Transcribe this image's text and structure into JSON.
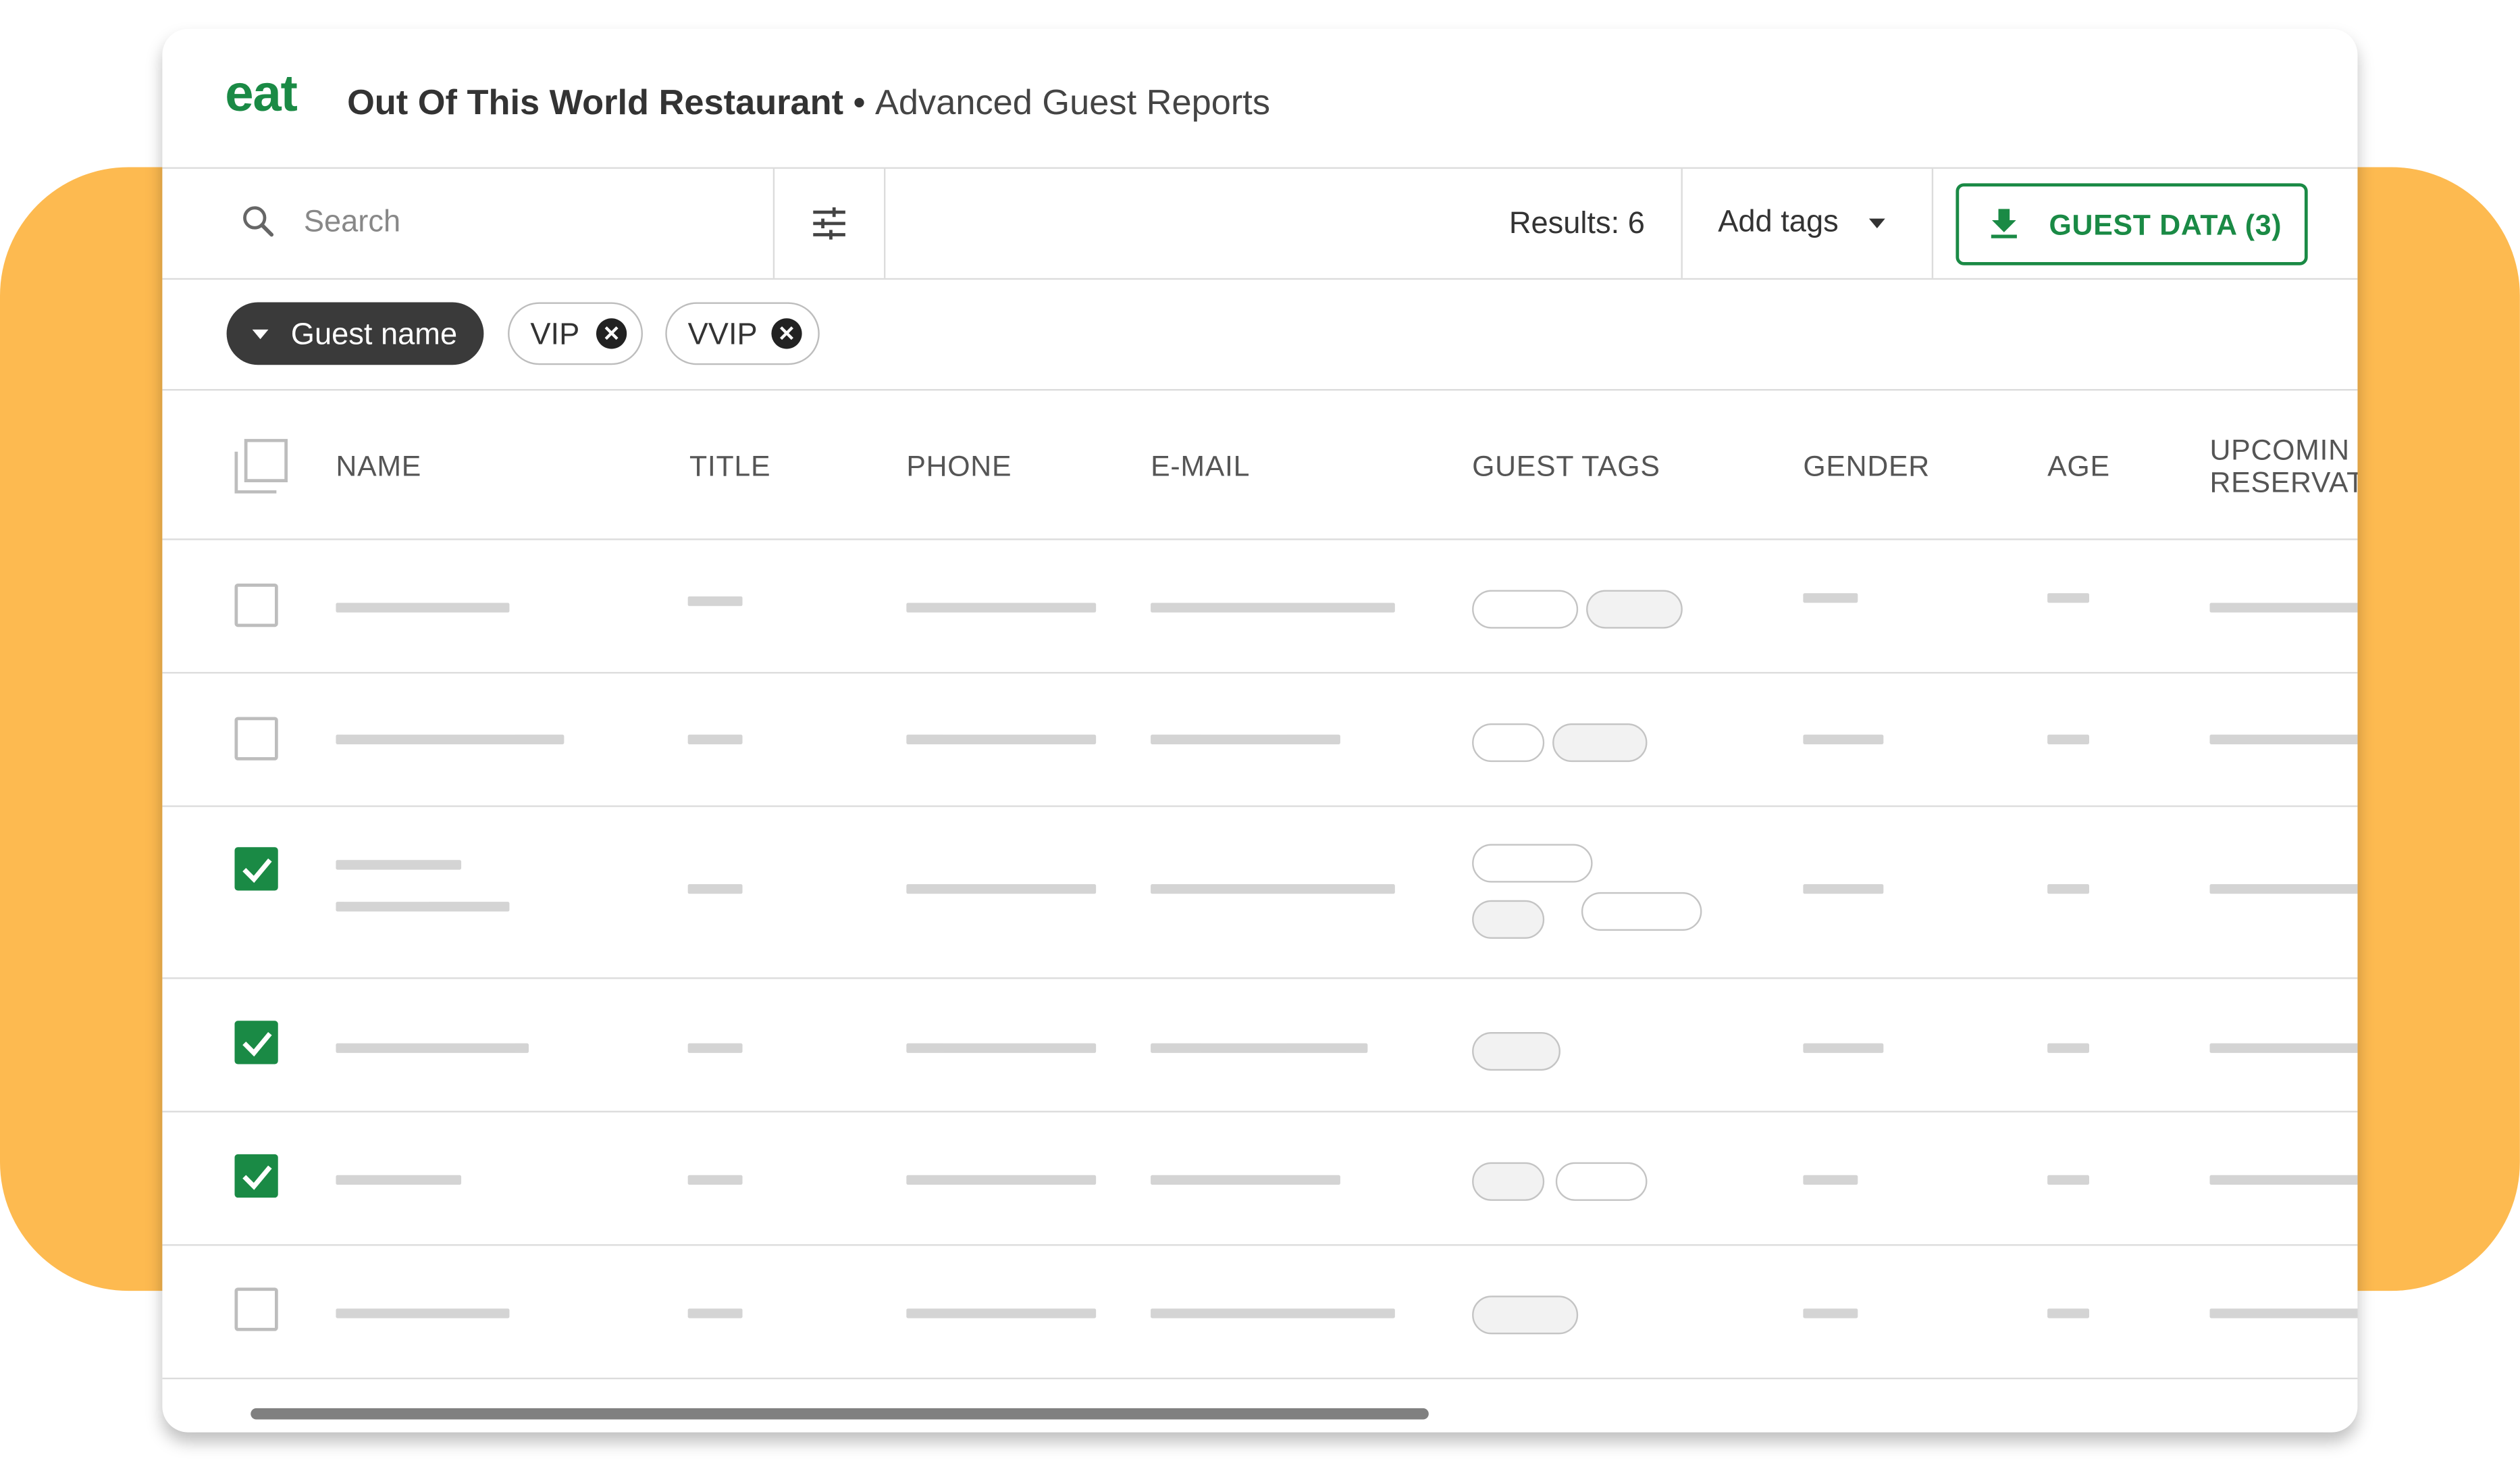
{
  "header": {
    "logo": "eat",
    "restaurant": "Out Of This World Restaurant",
    "separator": "•",
    "report": "Advanced Guest Reports"
  },
  "toolbar": {
    "search_placeholder": "Search",
    "results": "Results: 6",
    "add_tags": "Add tags",
    "guest_data": "GUEST DATA (3)"
  },
  "filters": {
    "group_chip": "Guest name",
    "chips": [
      "VIP",
      "VVIP"
    ]
  },
  "table": {
    "columns": [
      "NAME",
      "TITLE",
      "PHONE",
      "E-MAIL",
      "GUEST TAGS",
      "GENDER",
      "AGE",
      "UPCOMING RESERVATIONS"
    ],
    "column_display": [
      "NAME",
      "TITLE",
      "PHONE",
      "E-MAIL",
      "GUEST TAGS",
      "GENDER",
      "AGE",
      "UPCOMIN",
      "RESERVAT"
    ],
    "rows_checked": [
      false,
      false,
      true,
      true,
      true,
      false
    ]
  },
  "colors": {
    "accent": "#1a8a45",
    "background_band": "#FDBA50",
    "chip_dark": "#3a3a3a"
  },
  "icons": [
    "search-icon",
    "filter-sliders-icon",
    "caret-down-icon",
    "download-icon",
    "close-icon",
    "checkbox-icon",
    "check-icon"
  ]
}
